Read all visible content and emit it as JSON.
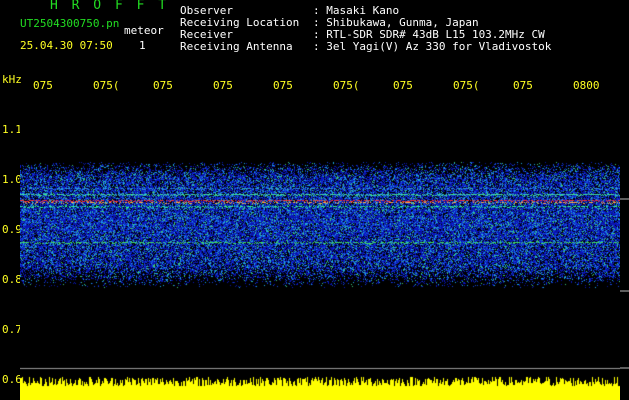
{
  "header": {
    "app_title": "H R O F F T",
    "file_name": "UT2504300750.pn",
    "mode": "meteor",
    "date_time": "25.04.30 07:50",
    "count": "1"
  },
  "info": [
    {
      "label": "Observer",
      "value": ": Masaki Kano"
    },
    {
      "label": "Receiving Location",
      "value": ": Shibukawa, Gunma, Japan"
    },
    {
      "label": "Receiver",
      "value": ": RTL-SDR SDR# 43dB L15 103.2MHz CW"
    },
    {
      "label": "Receiving Antenna",
      "value": ": 3el Yagi(V) Az 330 for Vladivostok"
    }
  ],
  "axis": {
    "unit": "kHz",
    "time_ticks": [
      "075",
      "075(",
      "075",
      "075",
      "075",
      "075(",
      "075",
      "075(",
      "075",
      "0800"
    ],
    "freq_ticks": [
      "1.1",
      "1.0",
      "0.9",
      "0.8",
      "0.7",
      "0.6"
    ]
  },
  "colors": {
    "background": "#000000",
    "label_green": "#22dd22",
    "axis_yellow": "#ffff22",
    "noise_blue": "#1414b4",
    "signal_red": "#ff2a2a"
  }
}
